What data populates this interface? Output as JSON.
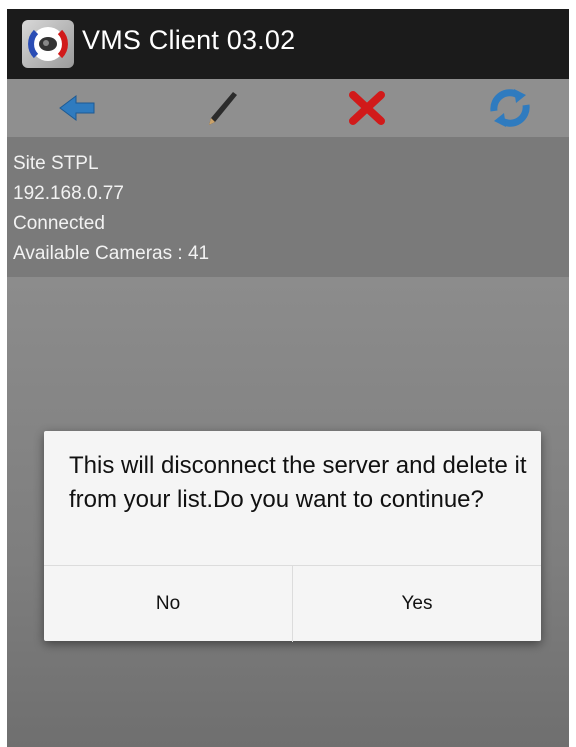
{
  "app": {
    "title": "VMS Client 03.02",
    "icon": "app-logo-icon"
  },
  "toolbar": {
    "buttons": [
      {
        "name": "back",
        "icon": "back-arrow-icon",
        "color": "#2f7bbf"
      },
      {
        "name": "edit",
        "icon": "pencil-icon",
        "color": "#222222"
      },
      {
        "name": "delete",
        "icon": "close-x-icon",
        "color": "#d11a1a"
      },
      {
        "name": "refresh",
        "icon": "refresh-icon",
        "color": "#2f7bbf"
      }
    ]
  },
  "site_info": {
    "name": "Site STPL",
    "ip": "192.168.0.77",
    "status": "Connected",
    "cameras": "Available Cameras : 41"
  },
  "dialog": {
    "message": "This will disconnect the server and delete it from your list.Do you want to continue?",
    "no_label": "No",
    "yes_label": "Yes"
  }
}
